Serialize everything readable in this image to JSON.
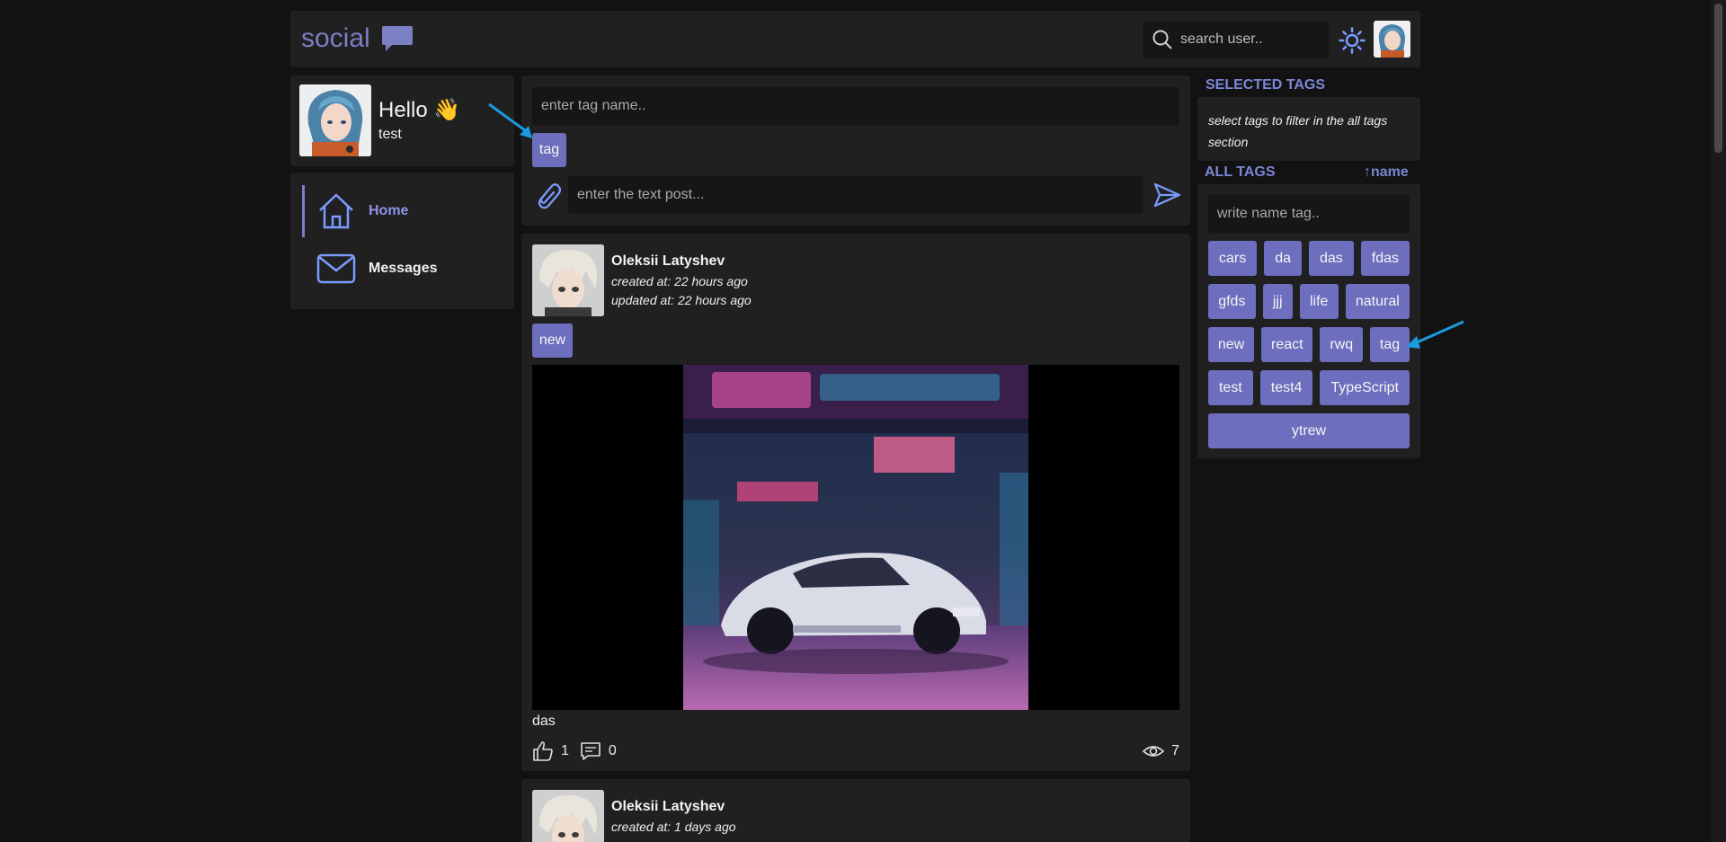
{
  "header": {
    "logo_text": "social",
    "search_placeholder": "search user..",
    "theme_icon": "sun-icon",
    "avatar": "user-avatar"
  },
  "profile": {
    "greeting": "Hello",
    "wave": "👋",
    "username": "test"
  },
  "nav": {
    "items": [
      {
        "label": "Home",
        "icon": "home-icon",
        "active": true
      },
      {
        "label": "Messages",
        "icon": "mail-icon",
        "active": false
      }
    ]
  },
  "composer": {
    "tag_placeholder": "enter tag name..",
    "selected_tag": "tag",
    "post_placeholder": "enter the text post..."
  },
  "posts": [
    {
      "author": "Oleksii Latyshev",
      "created": "created at: 22 hours ago",
      "updated": "updated at: 22 hours ago",
      "tag": "new",
      "text": "das",
      "likes": "1",
      "comments": "0",
      "views": "7"
    },
    {
      "author": "Oleksii Latyshev",
      "created": "created at: 1 days ago"
    }
  ],
  "sidebar": {
    "selected_title": "SELECTED TAGS",
    "selected_hint": "select tags to filter in the all tags section",
    "all_title": "ALL TAGS",
    "sort_label": "↑name",
    "tag_search_placeholder": "write name tag..",
    "tags": [
      "cars",
      "da",
      "das",
      "fdas",
      "gfds",
      "jjj",
      "life",
      "natural",
      "new",
      "react",
      "rwq",
      "tag",
      "test",
      "test4",
      "TypeScript",
      "ytrew"
    ]
  },
  "colors": {
    "accent": "#6d6ebd",
    "accent_text": "#7b87d6",
    "background": "#121212",
    "card": "#202020",
    "annotation_arrow": "#1a9be0"
  }
}
